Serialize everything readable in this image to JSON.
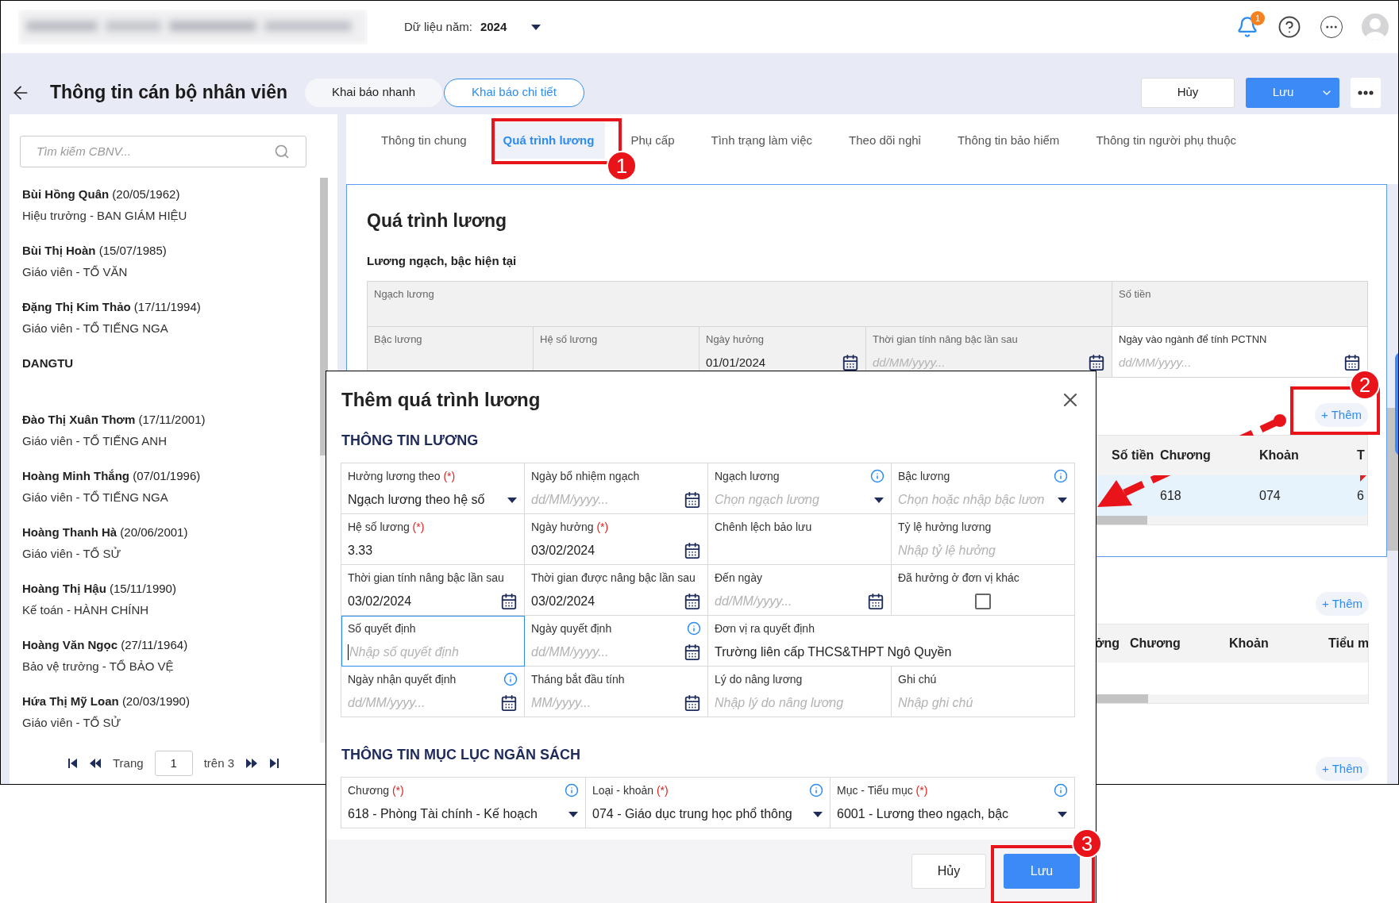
{
  "top_bar": {
    "year_label": "Dữ liệu năm:",
    "year": "2024",
    "notification_count": "1"
  },
  "header": {
    "title": "Thông tin cán bộ nhân viên",
    "modes": [
      {
        "label": "Khai báo nhanh",
        "selected": false
      },
      {
        "label": "Khai báo chi tiết",
        "selected": true
      }
    ],
    "cancel": "Hủy",
    "save": "Lưu"
  },
  "sidebar": {
    "search": {
      "placeholder": "Tìm kiếm CBNV..."
    },
    "employees": [
      {
        "name": "Bùi Hồng Quân",
        "dob": "(20/05/1962)",
        "role": "Hiệu trưởng - BAN GIÁM HIỆU"
      },
      {
        "name": "Bùi Thị Hoàn",
        "dob": "(15/07/1985)",
        "role": "Giáo viên - TỔ VĂN"
      },
      {
        "name": "Đặng Thị Kim Thảo",
        "dob": "(17/11/1994)",
        "role": "Giáo viên - TỔ TIẾNG NGA"
      },
      {
        "name": "DANGTU"
      },
      {
        "name": "Đào Thị Xuân Thơm",
        "dob": "(17/11/2001)",
        "role": "Giáo viên - TỔ TIẾNG ANH"
      },
      {
        "name": "Hoàng Minh Thắng",
        "dob": "(07/01/1996)",
        "role": "Giáo viên - TỔ TIẾNG NGA"
      },
      {
        "name": "Hoàng Thanh Hà",
        "dob": "(20/06/2001)",
        "role": "Giáo viên - TỔ SỬ"
      },
      {
        "name": "Hoàng Thị Hậu",
        "dob": "(15/11/1990)",
        "role": "Kế toán - HÀNH CHÍNH"
      },
      {
        "name": "Hoàng Văn Ngọc",
        "dob": "(27/11/1964)",
        "role": "Bảo vệ trưởng - TỔ BẢO VỆ"
      },
      {
        "name": "Hứa Thị Mỹ Loan",
        "dob": "(20/03/1990)",
        "role": "Giáo viên - TỔ SỬ"
      }
    ],
    "pagination": {
      "label": "Trang",
      "page": "1",
      "total": "trên 3"
    }
  },
  "tabs": [
    {
      "label": "Thông tin chung",
      "selected": false
    },
    {
      "label": "Quá trình lương",
      "selected": true
    },
    {
      "label": "Phụ cấp",
      "selected": false
    },
    {
      "label": "Tình trạng làm việc",
      "selected": false
    },
    {
      "label": "Theo dõi nghỉ",
      "selected": false
    },
    {
      "label": "Thông tin bảo hiểm",
      "selected": false
    },
    {
      "label": "Thông tin người phụ thuộc",
      "selected": false
    }
  ],
  "section": {
    "title": "Quá trình lương",
    "subtitle": "Lương ngạch, bậc hiện tại",
    "rows": [
      [
        {
          "label": "Ngạch lương",
          "disabled": true,
          "colspan": 4
        },
        {
          "label": "Số tiền",
          "disabled": true
        }
      ],
      [
        {
          "label": "Bậc lương",
          "disabled": true
        },
        {
          "label": "Hệ số lương",
          "disabled": true
        },
        {
          "label": "Ngày hưởng",
          "disabled": true,
          "kind": "date",
          "value": "01/01/2024"
        },
        {
          "label": "Thời gian tính nâng bậc lần sau",
          "disabled": true,
          "kind": "date",
          "placeholder": "dd/MM/yyyy..."
        },
        {
          "label": "Ngày vào ngành để tính PCTNN",
          "disabled": false,
          "kind": "date",
          "placeholder": "dd/MM/yyyy..."
        }
      ]
    ]
  },
  "history_tables": [
    {
      "add": "+ Thêm",
      "columns": [
        "Số tiền",
        "Chương",
        "Khoản",
        "T"
      ],
      "rows": [
        {
          "selected": true,
          "marked": true,
          "cells": [
            null,
            "618",
            "074",
            "6"
          ]
        }
      ]
    },
    {
      "add": "+ Thêm",
      "columns": [
        "ởng",
        "Chương",
        "Khoản",
        "Tiểu m"
      ]
    },
    {
      "add": "+ Thêm"
    }
  ],
  "dialog": {
    "title": "Thêm quá trình lương",
    "sections": [
      {
        "title": "THÔNG TIN LƯƠNG",
        "fields": [
          {
            "label": "Hưởng lương theo",
            "mark": "(*)",
            "kind": "select",
            "value": "Ngạch lương theo hệ số"
          },
          {
            "label": "Ngày bổ nhiệm ngạch",
            "kind": "date",
            "placeholder": "dd/MM/yyyy..."
          },
          {
            "label": "Ngạch lương",
            "info": true,
            "kind": "select",
            "placeholder": "Chọn ngạch lương"
          },
          {
            "label": "Bậc lương",
            "info": true,
            "kind": "select",
            "placeholder": "Chọn hoặc nhập bậc lươn"
          },
          {
            "label": "Hệ số lương",
            "mark": "(*)",
            "kind": "text",
            "value": "3.33"
          },
          {
            "label": "Ngày hưởng",
            "mark": "(*)",
            "kind": "date",
            "value": "03/02/2024"
          },
          {
            "label": "Chênh lệch bảo lưu",
            "kind": "text"
          },
          {
            "label": "Tỷ lệ hưởng lương",
            "kind": "text",
            "placeholder": "Nhập tỷ lệ hưởng"
          },
          {
            "label": "Thời gian tính nâng bậc lần sau",
            "kind": "date",
            "value": "03/02/2024"
          },
          {
            "label": "Thời gian được nâng bậc lần sau",
            "kind": "date",
            "value": "03/02/2024"
          },
          {
            "label": "Đến ngày",
            "kind": "date",
            "placeholder": "dd/MM/yyyy..."
          },
          {
            "label": "Đã hưởng ở đơn vị khác",
            "kind": "checkbox",
            "checked": false
          },
          {
            "label": "Số quyết định",
            "kind": "text",
            "placeholder": "Nhập số quyết định",
            "focused": true
          },
          {
            "label": "Ngày quyết định",
            "info": true,
            "kind": "date",
            "placeholder": "dd/MM/yyyy..."
          },
          {
            "label": "Đơn vị ra quyết định",
            "kind": "text",
            "value": "Trường liên cấp THCS&THPT Ngô Quyền",
            "colspan": 2
          },
          {
            "label": "Ngày nhận quyết định",
            "info": true,
            "kind": "date",
            "placeholder": "dd/MM/yyyy..."
          },
          {
            "label": "Tháng bắt đầu tính",
            "kind": "date",
            "placeholder": "MM/yyyy..."
          },
          {
            "label": "Lý do nâng lương",
            "kind": "text",
            "placeholder": "Nhập lý do nâng lương"
          },
          {
            "label": "Ghi chú",
            "kind": "text",
            "placeholder": "Nhập ghi chú"
          }
        ]
      },
      {
        "title": "THÔNG TIN MỤC LỤC NGÂN SÁCH",
        "fields": [
          {
            "label": "Chương",
            "mark": "(*)",
            "info": true,
            "kind": "select",
            "value": "618 - Phòng Tài chính - Kế hoạch"
          },
          {
            "label": "Loại - khoản",
            "mark": "(*)",
            "info": true,
            "kind": "select",
            "value": "074 - Giáo dục trung học phổ thông"
          },
          {
            "label": "Mục - Tiểu mục",
            "mark": "(*)",
            "info": true,
            "kind": "select",
            "value": "6001 - Lương theo ngạch, bậc"
          }
        ]
      }
    ],
    "cancel": "Hủy",
    "save": "Lưu"
  },
  "callouts": [
    {
      "number": "1"
    },
    {
      "number": "2"
    },
    {
      "number": "3"
    }
  ]
}
